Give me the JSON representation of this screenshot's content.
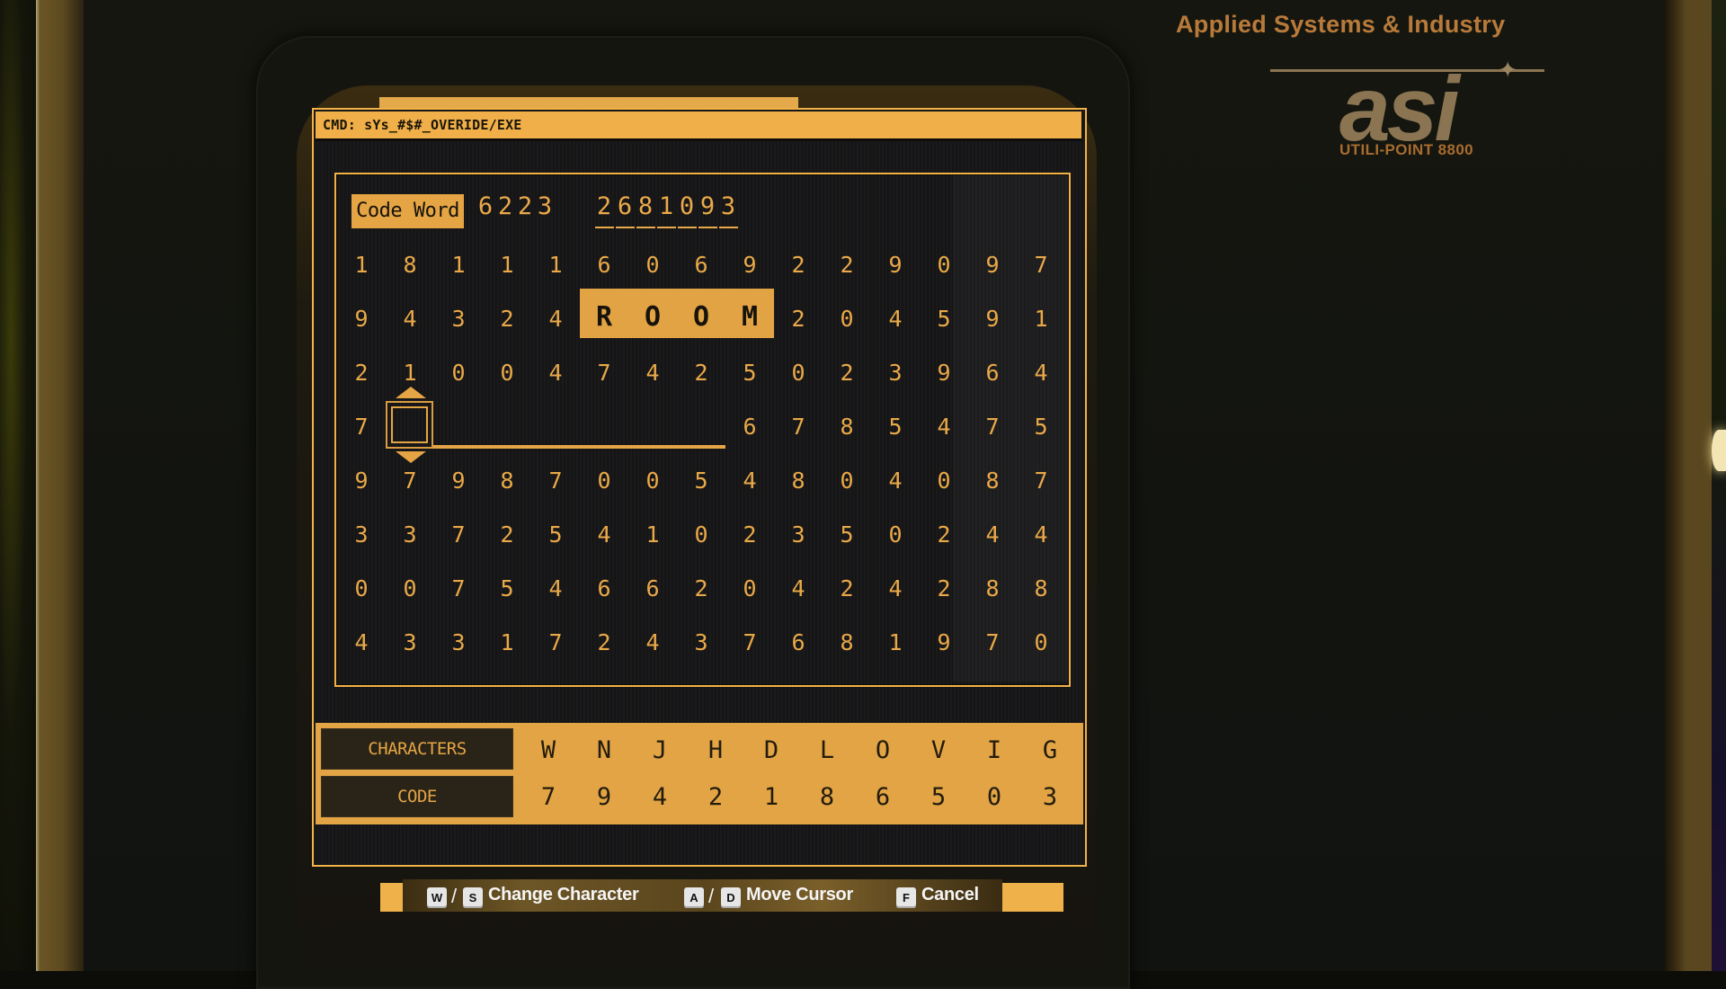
{
  "brand": {
    "company": "Applied Systems & Industry",
    "logo_text": "asi",
    "model": "UTILI-POINT 8800"
  },
  "terminal": {
    "command": "CMD: sYs_#$#_OVERIDE/EXE",
    "code_word_label": "Code Word",
    "code_prefix": [
      "6",
      "2",
      "2",
      "3"
    ],
    "code_entry": [
      "2",
      "6",
      "8",
      "1",
      "0",
      "9",
      "3"
    ],
    "highlight_word": [
      "R",
      "O",
      "O",
      "M"
    ],
    "grid": [
      [
        "1",
        "8",
        "1",
        "1",
        "1",
        "6",
        "0",
        "6",
        "9",
        "2",
        "2",
        "9",
        "0",
        "9",
        "7"
      ],
      [
        "9",
        "4",
        "3",
        "2",
        "4",
        "R",
        "O",
        "O",
        "M",
        "2",
        "0",
        "4",
        "5",
        "9",
        "1"
      ],
      [
        "2",
        "1",
        "0",
        "0",
        "4",
        "7",
        "4",
        "2",
        "5",
        "0",
        "2",
        "3",
        "9",
        "6",
        "4"
      ],
      [
        "7",
        "",
        "",
        "",
        "",
        "",
        "",
        "",
        "6",
        "7",
        "8",
        "5",
        "4",
        "7",
        "5"
      ],
      [
        "9",
        "7",
        "9",
        "8",
        "7",
        "0",
        "0",
        "5",
        "4",
        "8",
        "0",
        "4",
        "0",
        "8",
        "7"
      ],
      [
        "3",
        "3",
        "7",
        "2",
        "5",
        "4",
        "1",
        "0",
        "2",
        "3",
        "5",
        "0",
        "2",
        "4",
        "4"
      ],
      [
        "0",
        "0",
        "7",
        "5",
        "4",
        "6",
        "6",
        "2",
        "0",
        "4",
        "2",
        "4",
        "2",
        "8",
        "8"
      ],
      [
        "4",
        "3",
        "3",
        "1",
        "7",
        "2",
        "4",
        "3",
        "7",
        "6",
        "8",
        "1",
        "9",
        "7",
        "0"
      ]
    ],
    "input_cursor": {
      "row": 4,
      "column": 2,
      "slots": 7
    }
  },
  "cipher_table": {
    "characters_label": "CHARACTERS",
    "code_label": "CODE",
    "characters": [
      "W",
      "N",
      "J",
      "H",
      "D",
      "L",
      "O",
      "V",
      "I",
      "G"
    ],
    "codes": [
      "7",
      "9",
      "4",
      "2",
      "1",
      "8",
      "6",
      "5",
      "0",
      "3"
    ]
  },
  "controls": [
    {
      "keys": [
        "W",
        "S"
      ],
      "label": "Change Character"
    },
    {
      "keys": [
        "A",
        "D"
      ],
      "label": "Move Cursor"
    },
    {
      "keys": [
        "F"
      ],
      "label": "Cancel"
    }
  ],
  "colors": {
    "amber": "#f0af48",
    "screen_bg": "#1b1a1b",
    "brand_orange": "#b87a3a",
    "logo_tan": "#8a7452"
  }
}
